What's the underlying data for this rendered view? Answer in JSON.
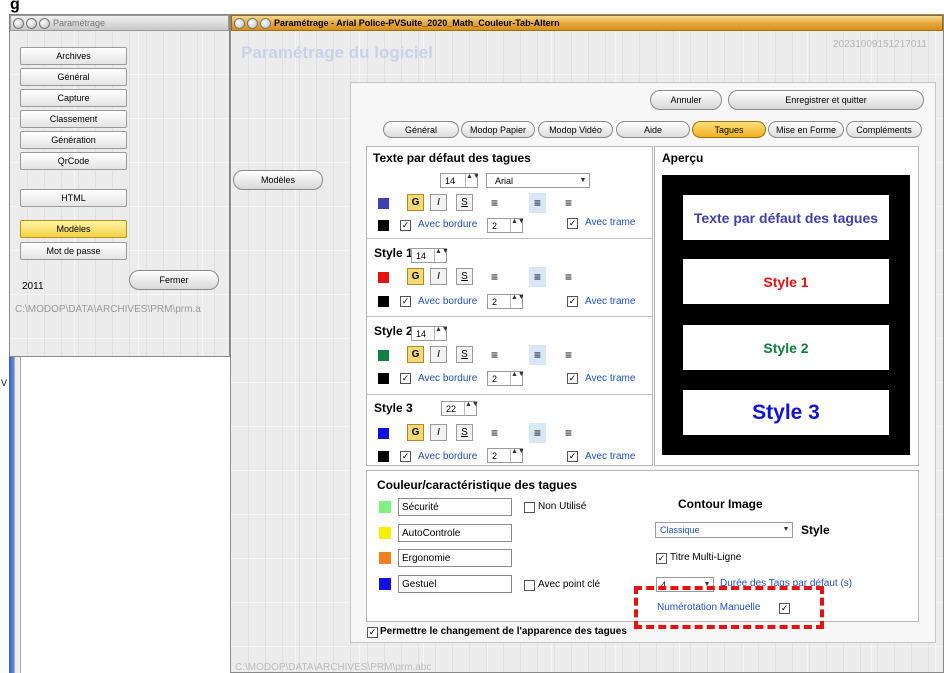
{
  "top_fragment": "g",
  "left_window": {
    "title": "Paramétrage",
    "nav": [
      "Archives",
      "Général",
      "Capture",
      "Classement",
      "Génération",
      "QrCode"
    ],
    "html_label": "HTML",
    "modeles_label": "Modèles",
    "password_label": "Mot de passe",
    "year": "2011",
    "close_label": "Fermer",
    "path": "C:\\MODOP\\DATA\\ARCHIVES\\PRM\\prm.a"
  },
  "side_v": "V",
  "main_window": {
    "title": "Paramétrage - Arial Police-PVSuite_2020_Math_Couleur-Tab-Altern",
    "heading": "Paramétrage du logiciel",
    "timestamp": "20231009151217011",
    "modeles_btn": "Modèles",
    "path_bottom": "C:\\MODOP\\DATA\\ARCHIVES\\PRM\\prm.abc",
    "annuler": "Annuler",
    "enregistrer": "Enregistrer et quitter",
    "tabs": [
      "Général",
      "Modop Papier",
      "Modop Vidéo",
      "Aide",
      "Tagues",
      "Mise en Forme",
      "Compléments"
    ]
  },
  "tags": {
    "default_title": "Texte par défaut des tagues",
    "default_size": "14",
    "font": "Arial",
    "avec_bordure": "Avec bordure",
    "avec_trame": "Avec trame",
    "bordure_value": "2",
    "bold_glyph": "G",
    "italic_glyph": "I",
    "underline_glyph": "S",
    "check_glyph": "✓",
    "spin_glyph": "▲▼",
    "dropdown_glyph": "▼",
    "styles": [
      {
        "name": "Style 1",
        "size": "14",
        "color": "#e81010"
      },
      {
        "name": "Style 2",
        "size": "14",
        "color": "#108040"
      },
      {
        "name": "Style 3",
        "size": "22",
        "color": "#1010e0"
      }
    ],
    "default_color": "#4040b0"
  },
  "preview": {
    "title": "Aperçu",
    "default_text": "Texte par défaut des tagues",
    "style1": "Style 1",
    "style2": "Style 2",
    "style3": "Style 3"
  },
  "colors_section": {
    "title": "Couleur/caractéristique des tagues",
    "rows": [
      {
        "label": "Sécurité",
        "color": "#80f080"
      },
      {
        "label": "AutoControle",
        "color": "#f5f000"
      },
      {
        "label": "Ergonomie",
        "color": "#f08020"
      },
      {
        "label": "Gestuel",
        "color": "#1010e0"
      }
    ],
    "non_utilise": "Non Utilisé",
    "avec_point_cle": "Avec point clé"
  },
  "contour": {
    "title": "Contour Image",
    "style_value": "Classique",
    "style_label": "Style",
    "titre_multiligne": "Titre Multi-Ligne",
    "duree_value": "4",
    "duree_label": "Durée des Tags par défaut (s)",
    "numerotation": "Numérotation Manuelle"
  },
  "permettre": "Permettre le changement de l'apparence des tagues"
}
